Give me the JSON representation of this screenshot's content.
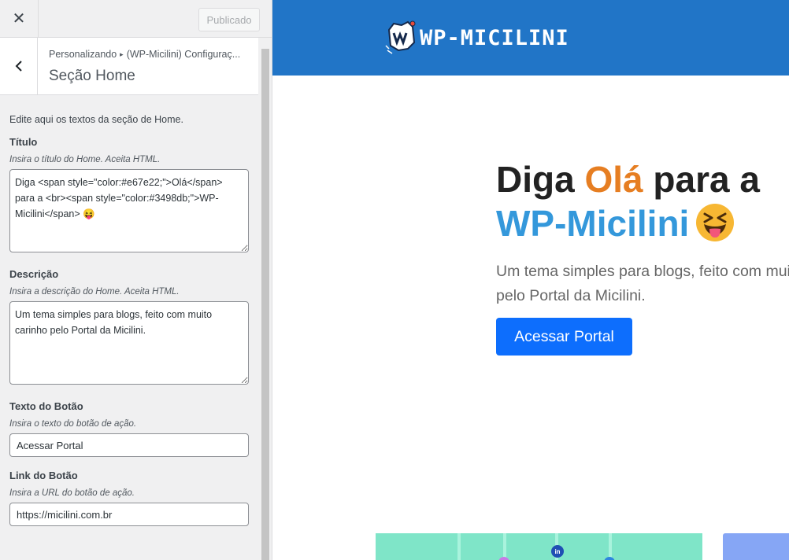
{
  "topbar": {
    "close_label": "✕",
    "publish_label": "Publicado"
  },
  "section": {
    "breadcrumb_root": "Personalizando",
    "breadcrumb_sep": "▸",
    "breadcrumb_parent": "(WP-Micilini) Configuraç...",
    "title": "Seção Home"
  },
  "controls": {
    "intro": "Edite aqui os textos da seção de Home.",
    "title_field": {
      "label": "Título",
      "desc": "Insira o título do Home. Aceita HTML.",
      "value": "Diga <span style=\"color:#e67e22;\">Olá</span> para a <br><span style=\"color:#3498db;\">WP-Micilini</span> 😝"
    },
    "desc_field": {
      "label": "Descrição",
      "desc": "Insira a descrição do Home. Aceita HTML.",
      "value": "Um tema simples para blogs, feito com muito carinho pelo Portal da Micilini."
    },
    "button_text_field": {
      "label": "Texto do Botão",
      "desc": "Insira o texto do botão de ação.",
      "value": "Acessar Portal"
    },
    "button_link_field": {
      "label": "Link do Botão",
      "desc": "Insira a URL do botão de ação.",
      "value": "https://micilini.com.br"
    }
  },
  "preview": {
    "site_name": "WP-MICILINI",
    "hero_title_1": "Diga ",
    "hero_title_highlight": "Olá",
    "hero_title_2": " para a",
    "hero_title_brand": "WP-Micilini",
    "hero_desc_line1": "Um tema simples para blogs, feito com muito",
    "hero_desc_line2": "pelo Portal da Micilini.",
    "hero_button": "Acessar Portal",
    "social_icon_label": "in"
  },
  "colors": {
    "header_bg": "#2175c7",
    "accent_orange": "#e67e22",
    "accent_blue": "#3498db",
    "button_bg": "#0d6efd"
  }
}
